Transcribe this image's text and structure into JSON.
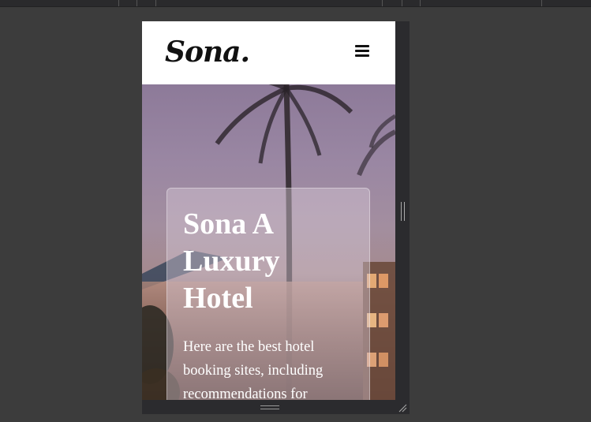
{
  "header": {
    "logo_text": "Sona."
  },
  "hero": {
    "title": "Sona A Luxury Hotel",
    "description": "Here are the best hotel booking sites, including recommendations for"
  },
  "icons": {
    "menu": "hamburger-menu-icon",
    "drag": "drag-handle-icon",
    "resize": "resize-corner-icon"
  },
  "colors": {
    "header_bg": "#ffffff",
    "editor_bg": "#3c3c3c",
    "frame_bg": "#2b2b2e",
    "text_light": "#ffffff",
    "logo": "#111111"
  }
}
